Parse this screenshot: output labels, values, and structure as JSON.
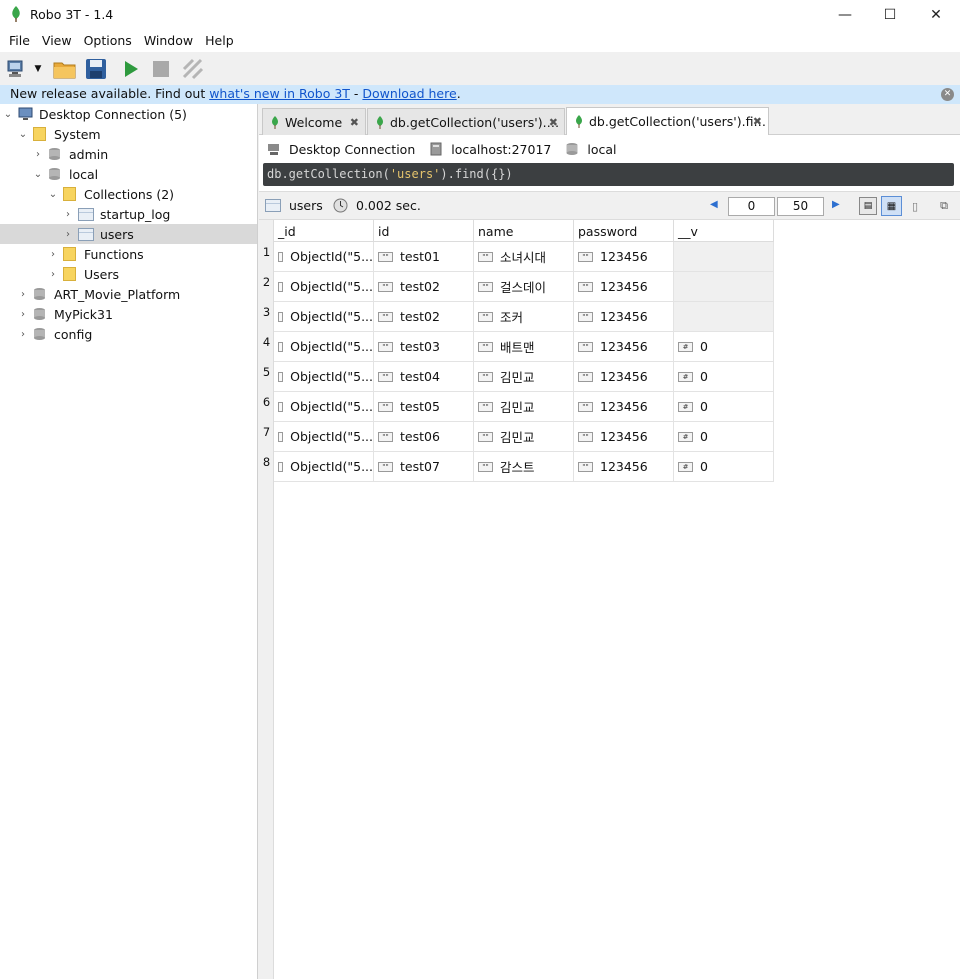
{
  "window": {
    "title": "Robo 3T - 1.4",
    "min": "—",
    "max": "☐",
    "close": "✕"
  },
  "menu": [
    "File",
    "View",
    "Options",
    "Window",
    "Help"
  ],
  "notice": {
    "prefix": "New release available. Find out ",
    "link1": "what's new in Robo 3T",
    "sep": " - ",
    "link2": "Download here",
    "suffix": "."
  },
  "tree": [
    {
      "label": "Desktop Connection (5)",
      "level": 0,
      "expanded": true,
      "icon": "monitor-icon"
    },
    {
      "label": "System",
      "level": 1,
      "expanded": true,
      "icon": "folder-icon"
    },
    {
      "label": "admin",
      "level": 2,
      "expanded": false,
      "icon": "database-icon"
    },
    {
      "label": "local",
      "level": 2,
      "expanded": true,
      "icon": "database-icon"
    },
    {
      "label": "Collections (2)",
      "level": 3,
      "expanded": true,
      "icon": "folder-icon"
    },
    {
      "label": "startup_log",
      "level": 4,
      "expanded": false,
      "icon": "table-icon"
    },
    {
      "label": "users",
      "level": 4,
      "expanded": false,
      "icon": "table-icon",
      "selected": true
    },
    {
      "label": "Functions",
      "level": 3,
      "expanded": false,
      "icon": "folder-icon"
    },
    {
      "label": "Users",
      "level": 3,
      "expanded": false,
      "icon": "folder-icon"
    },
    {
      "label": "ART_Movie_Platform",
      "level": 1,
      "expanded": false,
      "icon": "database-icon"
    },
    {
      "label": "MyPick31",
      "level": 1,
      "expanded": false,
      "icon": "database-icon"
    },
    {
      "label": "config",
      "level": 1,
      "expanded": false,
      "icon": "database-icon"
    }
  ],
  "tabs": [
    {
      "label": "Welcome",
      "close": "✖"
    },
    {
      "label": "db.getCollection('users').…",
      "close": "✖"
    },
    {
      "label": "db.getCollection('users').fi…",
      "close": "✖",
      "active": true
    }
  ],
  "connection": {
    "name": "Desktop Connection",
    "host": "localhost:27017",
    "db": "local"
  },
  "query": {
    "pre": "db.getCollection(",
    "str": "'users'",
    "post": ").find({})"
  },
  "result": {
    "collection": "users",
    "time": "0.002 sec.",
    "skip": "0",
    "limit": "50"
  },
  "columns": [
    "_id",
    "id",
    "name",
    "password",
    "__v"
  ],
  "rows": [
    {
      "n": "1",
      "oid": "ObjectId(\"5...",
      "id": "test01",
      "name": "소녀시대",
      "password": "123456",
      "v": ""
    },
    {
      "n": "2",
      "oid": "ObjectId(\"5...",
      "id": "test02",
      "name": "걸스데이",
      "password": "123456",
      "v": ""
    },
    {
      "n": "3",
      "oid": "ObjectId(\"5...",
      "id": "test02",
      "name": "조커",
      "password": "123456",
      "v": ""
    },
    {
      "n": "4",
      "oid": "ObjectId(\"5...",
      "id": "test03",
      "name": "배트맨",
      "password": "123456",
      "v": "0"
    },
    {
      "n": "5",
      "oid": "ObjectId(\"5...",
      "id": "test04",
      "name": "김민교",
      "password": "123456",
      "v": "0"
    },
    {
      "n": "6",
      "oid": "ObjectId(\"5...",
      "id": "test05",
      "name": "김민교",
      "password": "123456",
      "v": "0"
    },
    {
      "n": "7",
      "oid": "ObjectId(\"5...",
      "id": "test06",
      "name": "김민교",
      "password": "123456",
      "v": "0"
    },
    {
      "n": "8",
      "oid": "ObjectId(\"5...",
      "id": "test07",
      "name": "감스트",
      "password": "123456",
      "v": "0"
    }
  ],
  "colors": {
    "accent": "#cfe7fb",
    "query_bg": "#3c3f41",
    "leaf": "#3aa64a",
    "play": "#2e9a3e"
  }
}
